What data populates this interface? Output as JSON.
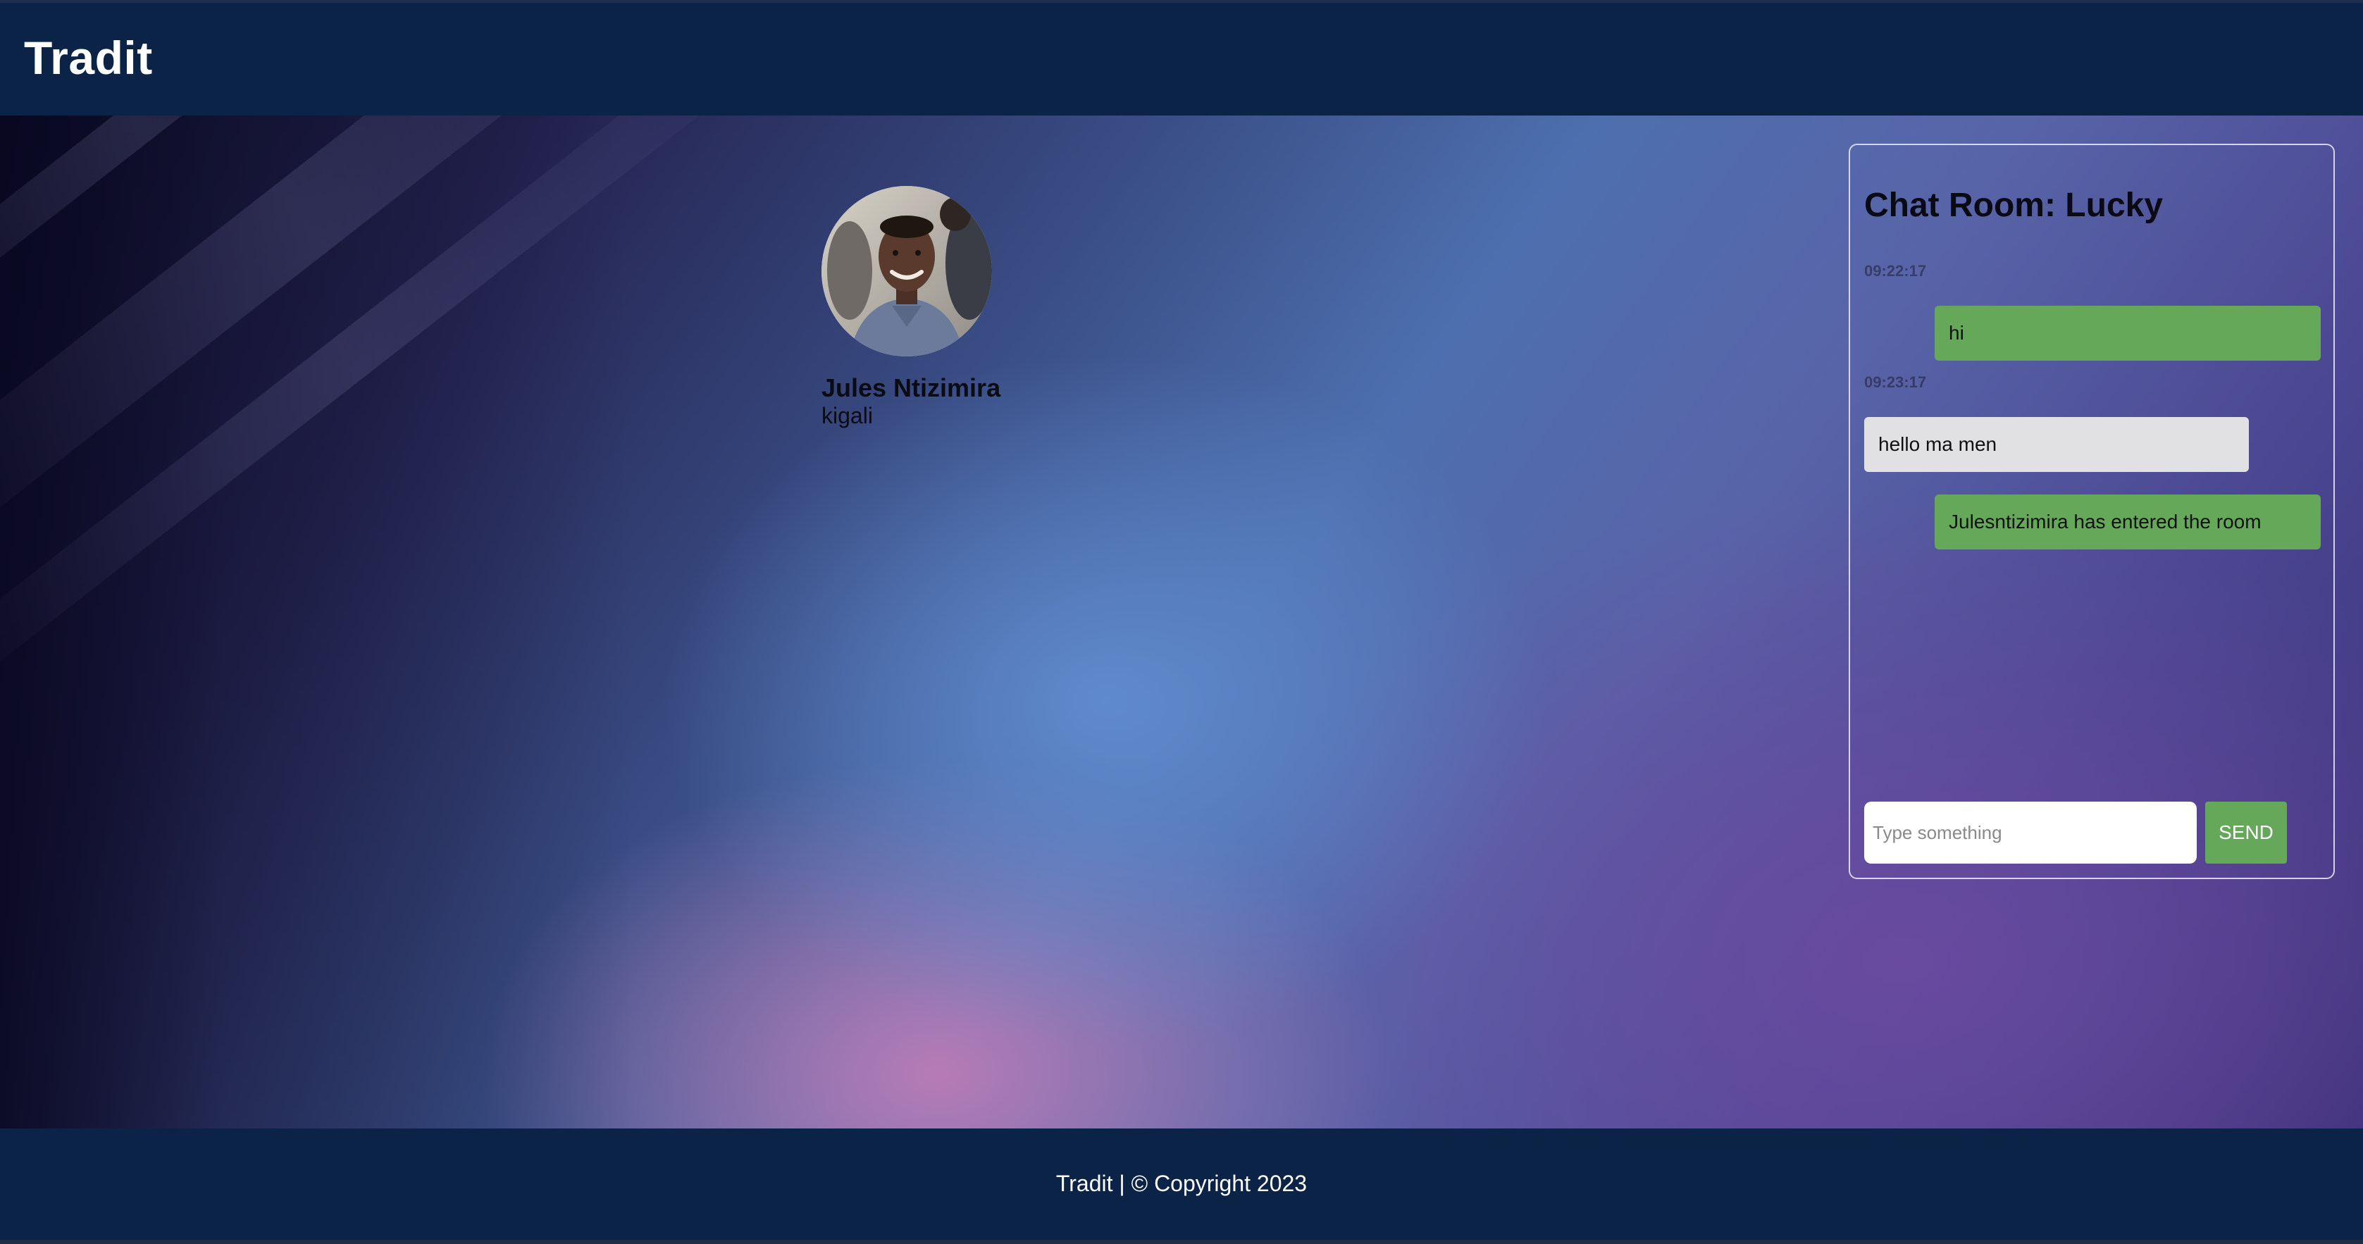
{
  "header": {
    "brand": "Tradit"
  },
  "profile": {
    "name": "Jules Ntizimira",
    "location": "kigali",
    "avatar_icon": "user-photo"
  },
  "chat": {
    "title": "Chat Room: Lucky",
    "messages": [
      {
        "timestamp": "09:22:17",
        "text": "hi",
        "sender": "self"
      },
      {
        "timestamp": "09:23:17",
        "text": "hello ma men",
        "sender": "other"
      },
      {
        "timestamp": "",
        "text": "Julesntizimira has entered the room",
        "sender": "self"
      }
    ],
    "input_placeholder": "Type something",
    "input_value": "",
    "send_label": "SEND"
  },
  "footer": {
    "text": "Tradit | © Copyright 2023"
  },
  "colors": {
    "header_bg": "#0c2348",
    "self_bubble": "#66a85a",
    "other_bubble": "#e1e1e3",
    "send_button": "#66a85a"
  }
}
